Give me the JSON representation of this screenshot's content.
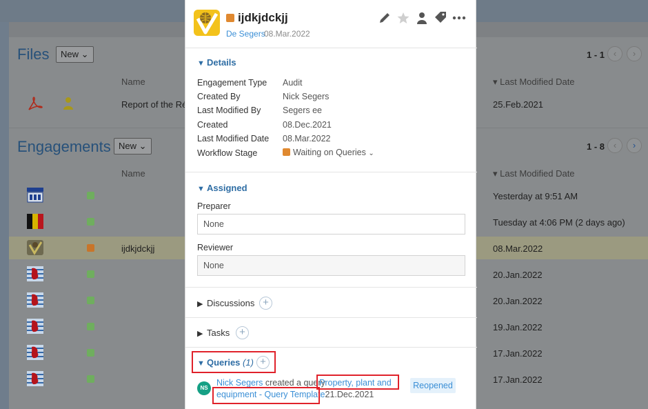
{
  "background": {
    "files": {
      "title": "Files",
      "new_label": "New",
      "pager": "1 - 1",
      "col_name": "Name",
      "col_modified": "Last Modified Date",
      "rows": [
        {
          "name": "Report of the Révi",
          "modified": "25.Feb.2021"
        }
      ]
    },
    "engagements": {
      "title": "Engagements",
      "new_label": "New",
      "pager": "1 - 8",
      "col_name": "Name",
      "col_modified": "Last Modified Date",
      "rows": [
        {
          "name": "",
          "modified": "Yesterday at 9:51 AM",
          "status_color": "#6fae5e"
        },
        {
          "name": "",
          "modified": "Tuesday at 4:06 PM (2 days ago)",
          "status_color": "#6fae5e"
        },
        {
          "name": "ijdkjdckjj",
          "modified": "08.Mar.2022",
          "status_color": "#c8752a"
        },
        {
          "name": "",
          "modified": "20.Jan.2022",
          "status_color": "#6fae5e"
        },
        {
          "name": "",
          "modified": "20.Jan.2022",
          "status_color": "#6fae5e"
        },
        {
          "name": "",
          "modified": "19.Jan.2022",
          "status_color": "#6fae5e"
        },
        {
          "name": "",
          "modified": "17.Jan.2022",
          "status_color": "#6fae5e"
        },
        {
          "name": "",
          "modified": "17.Jan.2022",
          "status_color": "#6fae5e"
        }
      ]
    }
  },
  "panel": {
    "title": "ijdkjdckjj",
    "owner_link": "De Segers",
    "date": "08.Mar.2022",
    "header_icons": [
      "pencil-icon",
      "star-icon",
      "user-icon",
      "tag-icon",
      "more-icon"
    ],
    "details": {
      "heading": "Details",
      "fields": [
        {
          "label": "Engagement Type",
          "value": "Audit"
        },
        {
          "label": "Created By",
          "value": "Nick Segers"
        },
        {
          "label": "Last Modified By",
          "value": "Segers ee"
        },
        {
          "label": "Created",
          "value": "08.Dec.2021"
        },
        {
          "label": "Last Modified Date",
          "value": "08.Mar.2022"
        }
      ],
      "workflow_label": "Workflow Stage",
      "workflow_value": "Waiting on Queries",
      "workflow_color": "#e08930"
    },
    "assigned": {
      "heading": "Assigned",
      "preparer_label": "Preparer",
      "preparer_value": "None",
      "reviewer_label": "Reviewer",
      "reviewer_value": "None"
    },
    "discussions": {
      "heading": "Discussions"
    },
    "tasks": {
      "heading": "Tasks"
    },
    "queries": {
      "heading": "Queries",
      "count": "(1)",
      "item": {
        "initials": "NS",
        "author": "Nick Segers",
        "action": "created a query",
        "link_line1": "Property, plant and",
        "link_line2": "equipment - Query Template",
        "date": "21.Dec.2021",
        "status": "Reopened"
      }
    }
  },
  "colors": {
    "accent": "#2e6da4",
    "link": "#3b8fd6",
    "highlight_box": "#e0212a"
  }
}
